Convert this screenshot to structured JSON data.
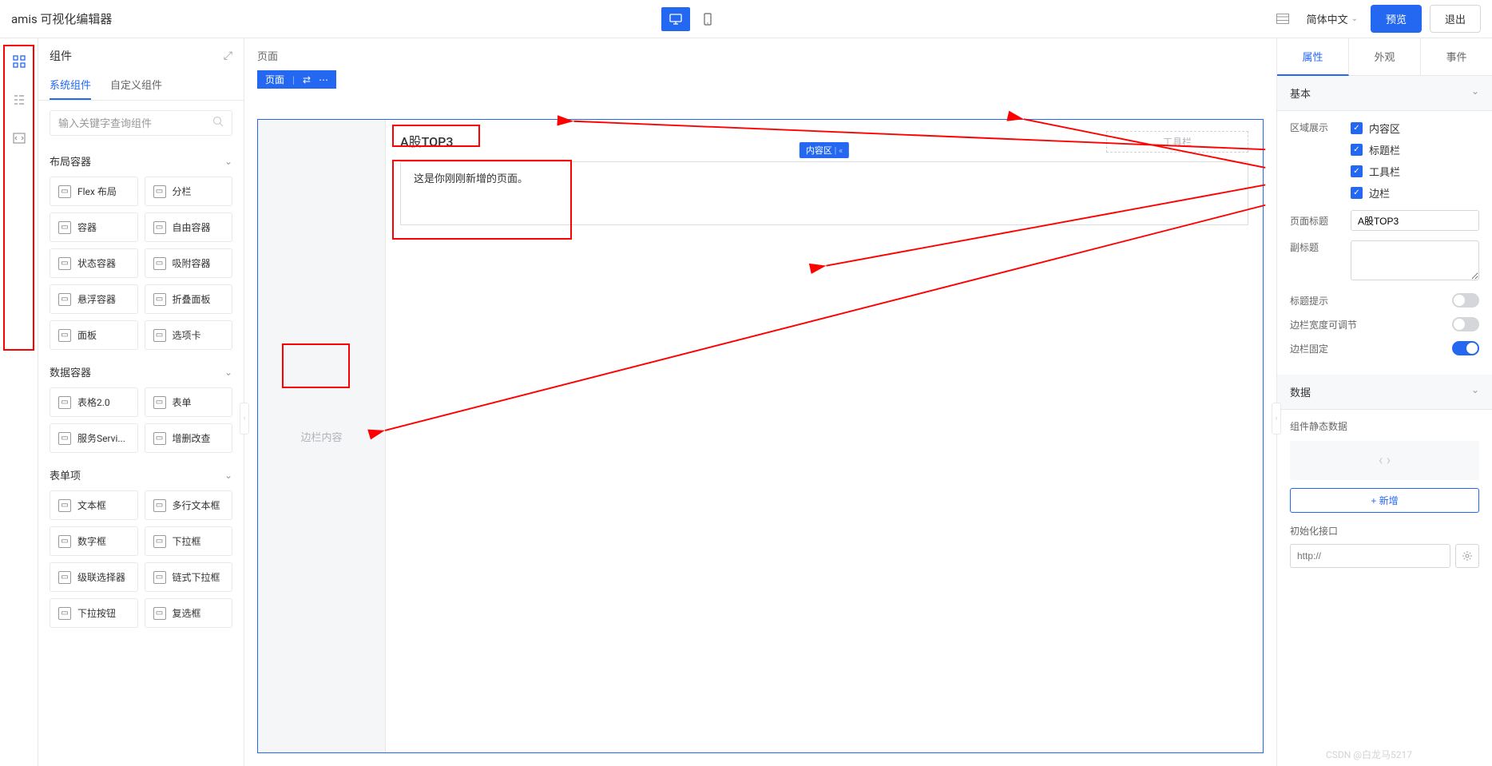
{
  "header": {
    "title": "amis 可视化编辑器",
    "language": "简体中文",
    "preview": "预览",
    "exit": "退出"
  },
  "leftPanel": {
    "title": "组件",
    "tabs": {
      "system": "系统组件",
      "custom": "自定义组件"
    },
    "searchPlaceholder": "输入关键字查询组件",
    "sections": {
      "layout": {
        "title": "布局容器",
        "items": [
          "Flex 布局",
          "分栏",
          "容器",
          "自由容器",
          "状态容器",
          "吸附容器",
          "悬浮容器",
          "折叠面板",
          "面板",
          "选项卡"
        ]
      },
      "data": {
        "title": "数据容器",
        "items": [
          "表格2.0",
          "表单",
          "服务Servi...",
          "增删改查"
        ]
      },
      "form": {
        "title": "表单项",
        "items": [
          "文本框",
          "多行文本框",
          "数字框",
          "下拉框",
          "级联选择器",
          "链式下拉框",
          "下拉按钮",
          "复选框"
        ]
      }
    }
  },
  "canvas": {
    "breadcrumb": "页面",
    "toolbarLabel": "页面",
    "pageTitle": "A股TOP3",
    "contentTag": "内容区",
    "toolbarPlaceholder": "工具栏",
    "sidebarPlaceholder": "边栏内容",
    "bodyText": "这是你刚刚新增的页面。"
  },
  "rightPanel": {
    "tabs": {
      "props": "属性",
      "style": "外观",
      "event": "事件"
    },
    "sections": {
      "basic": "基本",
      "data": "数据"
    },
    "labels": {
      "areaDisplay": "区域展示",
      "pageTitle": "页面标题",
      "subtitle": "副标题",
      "titleHint": "标题提示",
      "sidebarResize": "边栏宽度可调节",
      "sidebarFixed": "边栏固定",
      "staticData": "组件静态数据",
      "addNew": "+ 新增",
      "initApi": "初始化接口",
      "apiPlaceholder": "http://"
    },
    "checks": {
      "content": "内容区",
      "titleBar": "标题栏",
      "toolbar": "工具栏",
      "sidebar": "边栏"
    },
    "pageTitleValue": "A股TOP3"
  },
  "watermark": "CSDN @白龙马5217"
}
